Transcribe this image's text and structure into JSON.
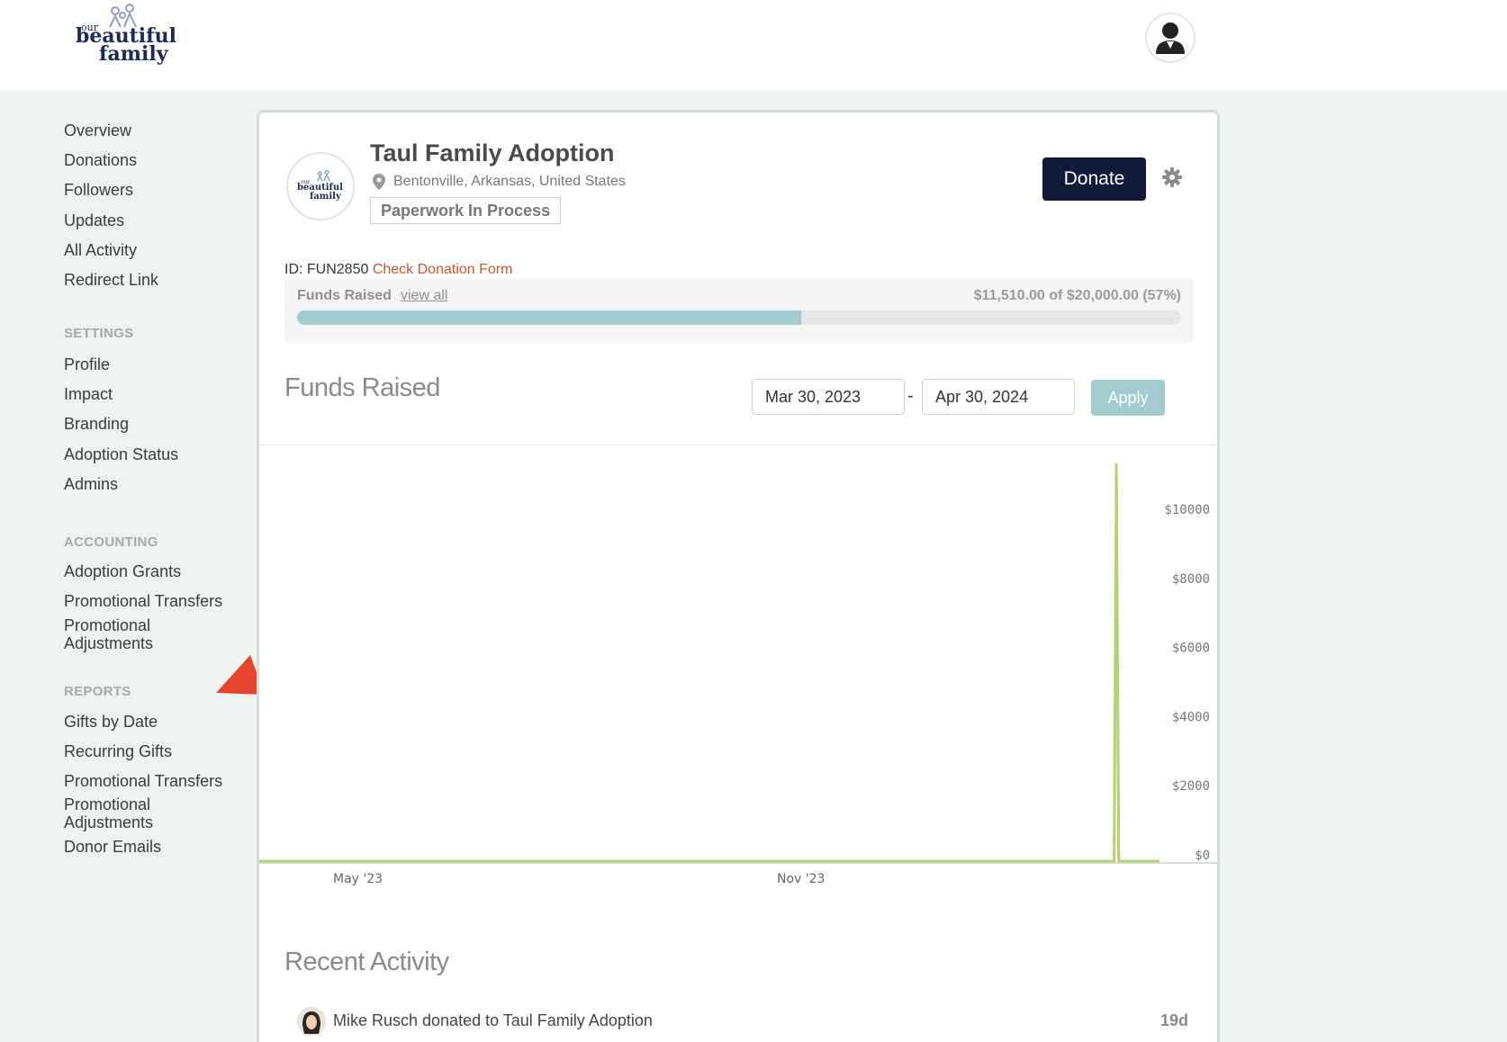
{
  "brand": {
    "logo_small": "our",
    "logo_line1": "beautiful",
    "logo_line2": "family",
    "navy": "#1c2a57",
    "accent": "#a2cbcd"
  },
  "sidebar": {
    "main": [
      "Overview",
      "Donations",
      "Followers",
      "Updates",
      "All Activity",
      "Redirect Link"
    ],
    "settings_header": "SETTINGS",
    "settings": [
      "Profile",
      "Impact",
      "Branding",
      "Adoption Status",
      "Admins"
    ],
    "accounting_header": "ACCOUNTING",
    "accounting": [
      "Adoption Grants",
      "Promotional Transfers",
      "Promotional Adjustments"
    ],
    "reports_header": "REPORTS",
    "reports": [
      "Gifts by Date",
      "Recurring Gifts",
      "Promotional Transfers",
      "Promotional Adjustments",
      "Donor Emails"
    ]
  },
  "fund": {
    "title": "Taul Family Adoption",
    "location": "Bentonville, Arkansas, United States",
    "status": "Paperwork In Process",
    "donate_label": "Donate",
    "id_text": "ID: FUN2850",
    "check_link": "Check Donation Form",
    "progress_label": "Funds Raised",
    "view_all": "view all",
    "amount_text": "$11,510.00 of $20,000.00 (57%)",
    "progress_fraction": 0.57
  },
  "funds_chart": {
    "section_title": "Funds Raised",
    "start_date": "Mar 30, 2023",
    "end_date": "Apr 30, 2024",
    "date_separator": "-",
    "apply_label": "Apply"
  },
  "chart_data": {
    "type": "line",
    "x_ticks": [
      "May '23",
      "Nov '23"
    ],
    "y_ticks": [
      "$0",
      "$2000",
      "$4000",
      "$6000",
      "$8000",
      "$10000"
    ],
    "ylim": [
      0,
      11510
    ],
    "series": [
      {
        "color": "#b5cf72",
        "points": [
          {
            "x": "2023-03-30",
            "y": 0
          },
          {
            "x": "2024-04-10",
            "y": 0
          },
          {
            "x": "2024-04-11",
            "y": 11510
          },
          {
            "x": "2024-04-12",
            "y": 0
          },
          {
            "x": "2024-04-30",
            "y": 0
          }
        ]
      }
    ]
  },
  "recent": {
    "section_title": "Recent Activity",
    "items": [
      {
        "text": "Mike Rusch donated to Taul Family Adoption",
        "time": "19d"
      }
    ]
  }
}
